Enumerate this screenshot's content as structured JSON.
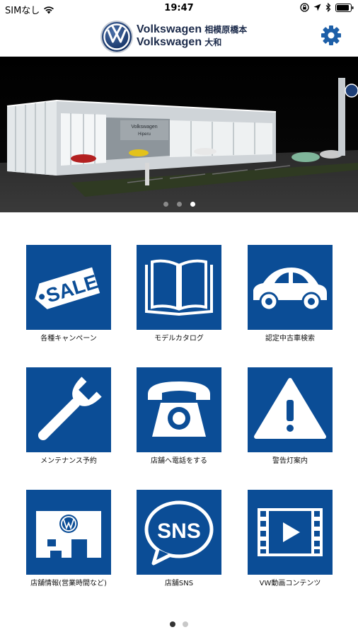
{
  "status": {
    "carrier": "SIMなし",
    "time": "19:47",
    "icons": [
      "wifi-icon",
      "lock-rotation-icon",
      "location-arrow-icon",
      "bluetooth-icon",
      "battery-icon"
    ]
  },
  "header": {
    "brand_line1": "Volkswagen",
    "place_line1": "相模原橋本",
    "brand_line2": "Volkswagen",
    "place_line2": "大和",
    "logo_icon": "vw-logo",
    "settings_icon": "gear-icon"
  },
  "banner": {
    "sign_text1": "Volkswagen",
    "sign_text2": "Hiperu",
    "slides": 3,
    "active_slide": 3
  },
  "menu": {
    "items": [
      {
        "label": "各種キャンペーン",
        "icon": "sale-tag-icon"
      },
      {
        "label": "モデルカタログ",
        "icon": "open-book-icon"
      },
      {
        "label": "認定中古車検索",
        "icon": "car-icon"
      },
      {
        "label": "メンテナンス予約",
        "icon": "wrench-icon"
      },
      {
        "label": "店舗へ電話をする",
        "icon": "telephone-icon"
      },
      {
        "label": "警告灯案内",
        "icon": "warning-icon"
      },
      {
        "label": "店舗情報(営業時間など)",
        "icon": "store-icon"
      },
      {
        "label": "店舗SNS",
        "icon": "sns-bubble-icon"
      },
      {
        "label": "VW動画コンテンツ",
        "icon": "video-icon"
      }
    ],
    "sale_text": "SALE",
    "sns_text": "SNS"
  },
  "pager": {
    "pages": 2,
    "active_page": 1
  },
  "colors": {
    "tile_blue": "#0b4d96",
    "brand_navy": "#1b2a4a",
    "gear_blue": "#1d5fa8"
  }
}
